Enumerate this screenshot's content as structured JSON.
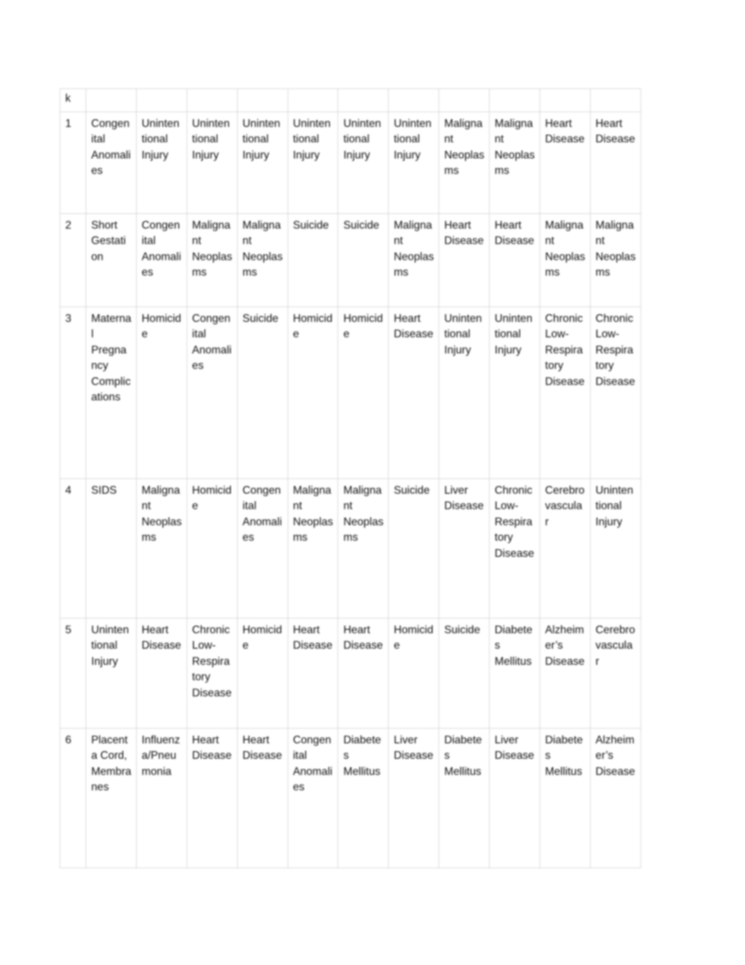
{
  "document": {
    "type": "table",
    "stray_header_label": "k",
    "column_count": 12,
    "data_column_count": 11,
    "row_count": 6,
    "border_color": "#d8d8d8",
    "text_color": "#0d0d0d",
    "background_color": "#ffffff"
  },
  "header_row": [
    "k",
    "",
    "",
    "",
    "",
    "",
    "",
    "",
    "",
    "",
    "",
    ""
  ],
  "rows": [
    {
      "rank": "1",
      "cells": [
        "Congenital Anomalies",
        "Unintentional Injury",
        "Unintentional Injury",
        "Unintentional Injury",
        "Unintentional Injury",
        "Unintentional Injury",
        "Unintentional Injury",
        "Malignant Neoplasms",
        "Malignant Neoplasms",
        "Heart Disease",
        "Heart Disease"
      ]
    },
    {
      "rank": "2",
      "cells": [
        "Short Gestation",
        "Congenital Anomalies",
        "Malignant Neoplasms",
        "Malignant Neoplasms",
        "Suicide",
        "Suicide",
        "Malignant Neoplasms",
        "Heart Disease",
        "Heart Disease",
        "Malignant Neoplasms",
        "Malignant Neoplasms"
      ]
    },
    {
      "rank": "3",
      "cells": [
        "Maternal Pregnancy Complications",
        "Homicide",
        "Congenital Anomalies",
        "Suicide",
        "Homicide",
        "Homicide",
        "Heart Disease",
        "Unintentional Injury",
        "Unintentional Injury",
        "Chronic Low-Respiratory Disease",
        "Chronic Low-Respiratory Disease"
      ]
    },
    {
      "rank": "4",
      "cells": [
        "SIDS",
        "Malignant Neoplasms",
        "Homicide",
        "Congenital Anomalies",
        "Malignant Neoplasms",
        "Malignant Neoplasms",
        "Suicide",
        "Liver Disease",
        "Chronic Low-Respiratory Disease",
        "Cerebrovascular",
        "Unintentional Injury"
      ]
    },
    {
      "rank": "5",
      "cells": [
        "Unintentional Injury",
        "Heart Disease",
        "Chronic Low-Respiratory Disease",
        "Homicide",
        "Heart Disease",
        "Heart Disease",
        "Homicide",
        "Suicide",
        "Diabetes Mellitus",
        "Alzheimer’s Disease",
        "Cerebrovascular"
      ]
    },
    {
      "rank": "6",
      "cells": [
        "Placenta Cord, Membranes",
        "Influenza/Pneumonia",
        "Heart Disease",
        "Heart Disease",
        "Congenital Anomalies",
        "Diabetes Mellitus",
        "Liver Disease",
        "Diabetes Mellitus",
        "Liver Disease",
        "Diabetes Mellitus",
        "Alzheimer’s Disease"
      ]
    }
  ]
}
